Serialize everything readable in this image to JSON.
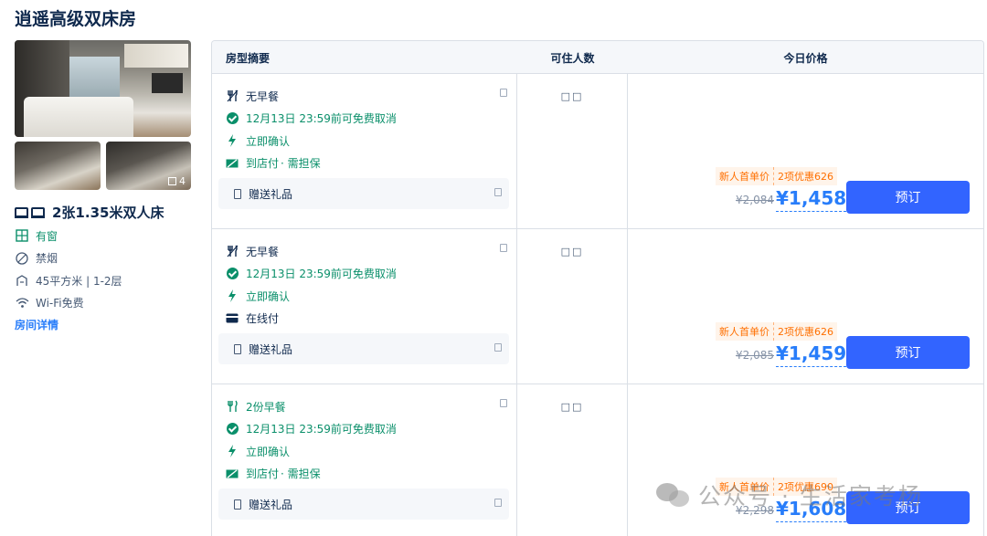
{
  "room": {
    "title": "逍遥高级双床房",
    "photo_count": "4",
    "bed_type": "2张1.35米双人床",
    "facilities": {
      "window": "有窗",
      "smoking": "禁烟",
      "area_floor": "45平方米 | 1-2层",
      "wifi": "Wi-Fi免费"
    },
    "detail_link": "房间详情"
  },
  "table": {
    "headers": {
      "summary": "房型摘要",
      "occupancy": "可住人数",
      "price": "今日价格"
    },
    "rows": [
      {
        "meal": "无早餐",
        "cancel": "12月13日 23:59前可免费取消",
        "confirm": "立即确认",
        "payment": "到店付",
        "payment_note": "· 需担保",
        "gift": "赠送礼品",
        "occupancy": "□□",
        "promo_new": "新人首单价",
        "promo_discount": "2项优惠626",
        "original_price": "¥2,084",
        "price": "¥1,458",
        "book_label": "预订"
      },
      {
        "meal": "无早餐",
        "cancel": "12月13日 23:59前可免费取消",
        "confirm": "立即确认",
        "payment": "在线付",
        "payment_note": "",
        "gift": "赠送礼品",
        "occupancy": "□□",
        "promo_new": "新人首单价",
        "promo_discount": "2项优惠626",
        "original_price": "¥2,085",
        "price": "¥1,459",
        "book_label": "预订"
      },
      {
        "meal": "2份早餐",
        "cancel": "12月13日 23:59前可免费取消",
        "confirm": "立即确认",
        "payment": "到店付",
        "payment_note": "· 需担保",
        "gift": "赠送礼品",
        "occupancy": "□□",
        "promo_new": "新人首单价",
        "promo_discount": "2项优惠690",
        "original_price": "¥2,298",
        "price": "¥1,608",
        "book_label": "预订"
      }
    ]
  },
  "watermark": "公众号 · 生活家考杨",
  "colors": {
    "accent": "#287dfa",
    "button": "#3264ff",
    "green": "#0a8f6a",
    "promo": "#ff6f00"
  }
}
